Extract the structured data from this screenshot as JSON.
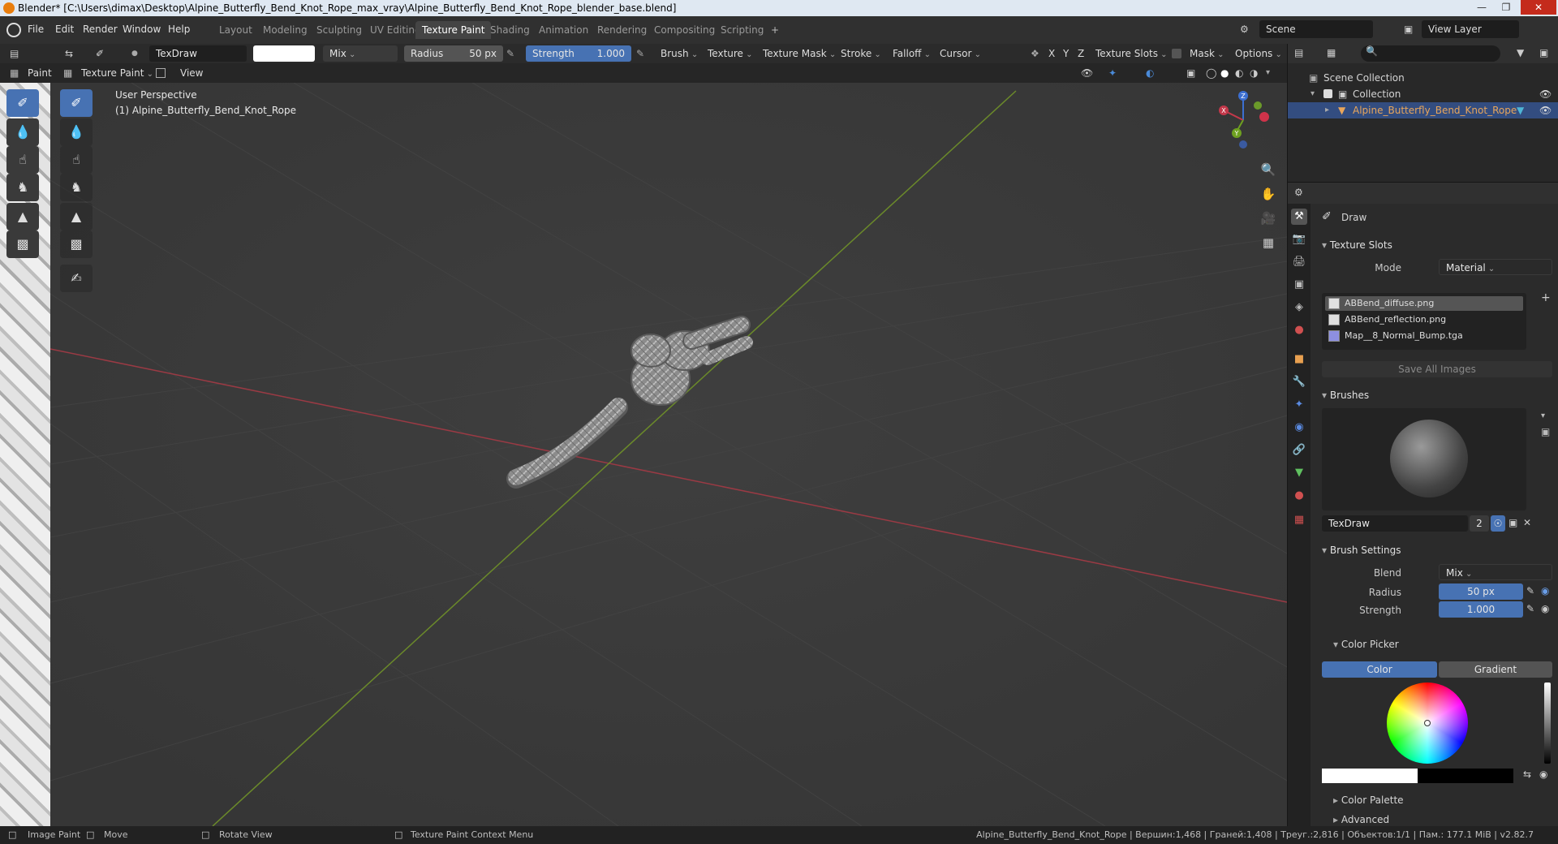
{
  "window": {
    "title": "Blender* [C:\\Users\\dimax\\Desktop\\Alpine_Butterfly_Bend_Knot_Rope_max_vray\\Alpine_Butterfly_Bend_Knot_Rope_blender_base.blend]"
  },
  "menu": [
    "File",
    "Edit",
    "Render",
    "Window",
    "Help"
  ],
  "workspaces": [
    "Layout",
    "Modeling",
    "Sculpting",
    "UV Editing",
    "Texture Paint",
    "Shading",
    "Animation",
    "Rendering",
    "Compositing",
    "Scripting"
  ],
  "active_workspace": "Texture Paint",
  "add_workspace": "+",
  "scene": "Scene",
  "view_layer": "View Layer",
  "tool_header": {
    "brush_name": "TexDraw",
    "blend": "Mix",
    "radius_label": "Radius",
    "radius_value": "50 px",
    "strength_label": "Strength",
    "strength_value": "1.000",
    "menus": [
      "Brush",
      "Texture",
      "Texture Mask",
      "Stroke",
      "Falloff",
      "Cursor"
    ],
    "axes": [
      "X",
      "Y",
      "Z"
    ],
    "texture_slots": "Texture Slots",
    "mask": "Mask",
    "options": "Options"
  },
  "header2": {
    "paint": "Paint",
    "mode": "Texture Paint",
    "view": "View"
  },
  "viewport": {
    "perspective": "User Perspective",
    "object_label": "(1) Alpine_Butterfly_Bend_Knot_Rope",
    "gizmo": {
      "z": "Z",
      "y": "Y",
      "x": "X"
    },
    "colors": {
      "x_axis": "#9a3a44",
      "y_axis": "#6b8a2a",
      "background": "#3b3b3b"
    }
  },
  "outliner": {
    "root": "Scene Collection",
    "collection": "Collection",
    "object": "Alpine_Butterfly_Bend_Knot_Rope"
  },
  "properties": {
    "active_tool": "Draw",
    "texture_slots": {
      "title": "Texture Slots",
      "mode_label": "Mode",
      "mode_value": "Material",
      "items": [
        "ABBend_diffuse.png",
        "ABBend_reflection.png",
        "Map__8_Normal_Bump.tga"
      ],
      "save_all": "Save All Images"
    },
    "brushes": {
      "title": "Brushes",
      "name": "TexDraw",
      "users": "2"
    },
    "brush_settings": {
      "title": "Brush Settings",
      "blend_label": "Blend",
      "blend_value": "Mix",
      "radius_label": "Radius",
      "radius_value": "50 px",
      "strength_label": "Strength",
      "strength_value": "1.000"
    },
    "color_picker": {
      "title": "Color Picker",
      "tab_color": "Color",
      "tab_gradient": "Gradient"
    },
    "color_palette": "Color Palette",
    "advanced": "Advanced"
  },
  "statusbar": {
    "left": [
      "Image Paint",
      "Move",
      "Rotate View",
      "Texture Paint Context Menu"
    ],
    "right": "Alpine_Butterfly_Bend_Knot_Rope | Вершин:1,468 | Граней:1,408 | Треуг.:2,816 | Объектов:1/1 | Пам.: 177.1 MiB | v2.82.7"
  },
  "accent": "#4772b3"
}
